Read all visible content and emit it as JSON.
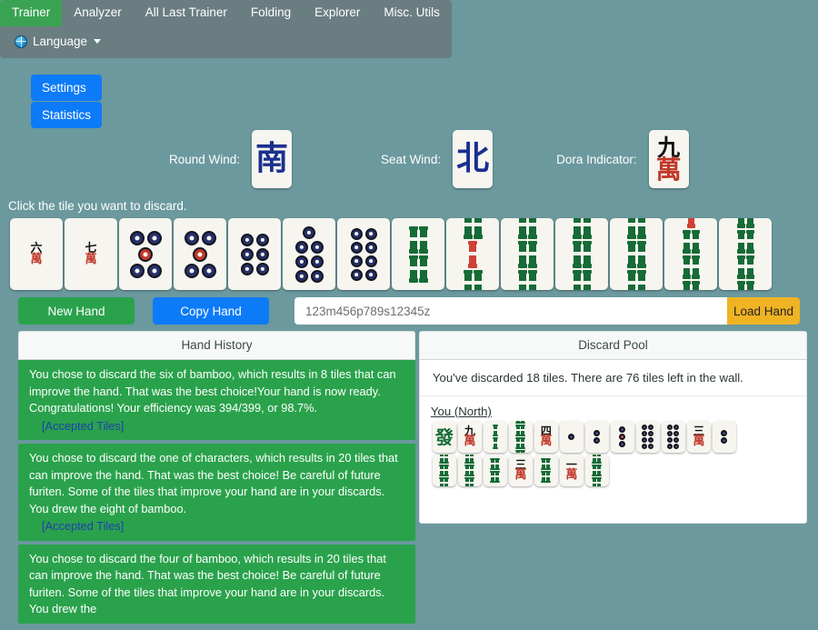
{
  "nav": {
    "tabs": [
      {
        "label": "Trainer",
        "active": true
      },
      {
        "label": "Analyzer",
        "active": false
      },
      {
        "label": "All Last Trainer",
        "active": false
      },
      {
        "label": "Folding",
        "active": false
      },
      {
        "label": "Explorer",
        "active": false
      },
      {
        "label": "Misc. Utils",
        "active": false
      }
    ],
    "language_label": "Language",
    "language_icon": "globe-icon",
    "caret_icon": "chevron-down-icon"
  },
  "side_buttons": [
    {
      "label": "Settings"
    },
    {
      "label": "Statistics"
    }
  ],
  "info": {
    "round_wind_label": "Round Wind:",
    "round_wind_tile": {
      "type": "honor",
      "glyph": "南",
      "name": "south-wind"
    },
    "seat_wind_label": "Seat Wind:",
    "seat_wind_tile": {
      "type": "honor",
      "glyph": "北",
      "name": "north-wind"
    },
    "dora_label": "Dora Indicator:",
    "dora_tile": {
      "type": "man",
      "num": "九",
      "wan": "萬",
      "name": "nine-of-characters"
    }
  },
  "prompt": "Click the tile you want to discard.",
  "hand": [
    {
      "type": "man",
      "num": "六",
      "wan": "萬",
      "name": "six-of-characters"
    },
    {
      "type": "man",
      "num": "七",
      "wan": "萬",
      "name": "seven-of-characters"
    },
    {
      "type": "pin",
      "count": 5,
      "red_index": 2,
      "name": "five-of-circles"
    },
    {
      "type": "pin",
      "count": 5,
      "red_index": 2,
      "name": "five-of-circles"
    },
    {
      "type": "pin",
      "count": 6,
      "red_index": -1,
      "name": "six-of-circles"
    },
    {
      "type": "pin",
      "count": 7,
      "red_index": -1,
      "name": "seven-of-circles"
    },
    {
      "type": "pin",
      "count": 8,
      "red_index": -1,
      "name": "eight-of-circles"
    },
    {
      "type": "sou",
      "count": 4,
      "red_index": -1,
      "name": "four-of-bamboo"
    },
    {
      "type": "sou",
      "count": 5,
      "red_index": 2,
      "name": "five-of-bamboo-red"
    },
    {
      "type": "sou",
      "count": 6,
      "red_index": -1,
      "name": "six-of-bamboo"
    },
    {
      "type": "sou",
      "count": 6,
      "red_index": -1,
      "name": "six-of-bamboo"
    },
    {
      "type": "sou",
      "count": 6,
      "red_index": -1,
      "name": "six-of-bamboo"
    },
    {
      "type": "sou",
      "count": 7,
      "red_index": 0,
      "name": "seven-of-bamboo"
    },
    {
      "type": "sou",
      "count": 8,
      "red_index": -1,
      "name": "eight-of-bamboo"
    }
  ],
  "controls": {
    "new_hand_label": "New Hand",
    "copy_hand_label": "Copy Hand",
    "hand_input_placeholder": "123m456p789s12345z",
    "hand_input_value": "",
    "load_hand_label": "Load Hand"
  },
  "hand_history": {
    "title": "Hand History",
    "accepted_tiles_label": "[Accepted Tiles]",
    "entries": [
      {
        "text": "You chose to discard the six of bamboo, which results in 8 tiles that can improve the hand. That was the best choice!Your hand is now ready. Congratulations! Your efficiency was 394/399, or 98.7%.",
        "has_accepted": true
      },
      {
        "text": "You chose to discard the one of characters, which results in 20 tiles that can improve the hand. That was the best choice! Be careful of future furiten. Some of the tiles that improve your hand are in your discards. You drew the eight of bamboo.",
        "has_accepted": true
      },
      {
        "text": "You chose to discard the four of bamboo, which results in 20 tiles that can improve the hand. That was the best choice! Be careful of future furiten. Some of the tiles that improve your hand are in your discards. You drew the",
        "has_accepted": false
      }
    ]
  },
  "discard_pool": {
    "title": "Discard Pool",
    "summary": "You've discarded 18 tiles. There are 76 tiles left in the wall.",
    "player_label": "You (North)",
    "rows": [
      [
        {
          "type": "hatsu",
          "glyph": "發",
          "name": "green-dragon"
        },
        {
          "type": "man",
          "num": "九",
          "wan": "萬",
          "name": "nine-of-characters"
        },
        {
          "type": "sou",
          "count": 2,
          "red_index": -1,
          "name": "two-of-bamboo"
        },
        {
          "type": "sou",
          "count": 8,
          "red_index": -1,
          "name": "eight-of-bamboo"
        },
        {
          "type": "man",
          "num": "四",
          "wan": "萬",
          "name": "four-of-characters"
        },
        {
          "type": "pin",
          "count": 1,
          "red_index": -1,
          "name": "one-of-circles"
        },
        {
          "type": "pin",
          "count": 2,
          "red_index": -1,
          "name": "two-of-circles"
        },
        {
          "type": "pin",
          "count": 3,
          "red_index": 1,
          "name": "three-of-circles"
        },
        {
          "type": "pin",
          "count": 8,
          "red_index": -1,
          "name": "eight-of-circles"
        },
        {
          "type": "pin",
          "count": 8,
          "red_index": -1,
          "name": "eight-of-circles"
        },
        {
          "type": "man",
          "num": "三",
          "wan": "萬",
          "name": "three-of-characters"
        },
        {
          "type": "pin",
          "count": 2,
          "red_index": -1,
          "name": "two-of-circles"
        }
      ],
      [
        {
          "type": "sou",
          "count": 6,
          "red_index": -1,
          "name": "six-of-bamboo"
        },
        {
          "type": "sou",
          "count": 6,
          "red_index": -1,
          "name": "six-of-bamboo"
        },
        {
          "type": "sou",
          "count": 4,
          "red_index": -1,
          "name": "four-of-bamboo"
        },
        {
          "type": "man",
          "num": "三",
          "wan": "萬",
          "name": "three-of-characters"
        },
        {
          "type": "sou",
          "count": 4,
          "red_index": -1,
          "name": "four-of-bamboo"
        },
        {
          "type": "man",
          "num": "一",
          "wan": "萬",
          "name": "one-of-characters"
        },
        {
          "type": "sou",
          "count": 6,
          "red_index": -1,
          "name": "six-of-bamboo"
        }
      ]
    ]
  },
  "colors": {
    "background": "#6b999e",
    "nav_bar": "#6a7d80",
    "active_tab": "#3aa353",
    "primary_blue": "#0d7bf7",
    "green": "#2aa24c",
    "amber": "#f0b323",
    "tile_face": "#f7f5ef",
    "man_red": "#c0392b",
    "sou_green": "#166b36",
    "pin_blue": "#26306b",
    "honor_blue": "#1a2f8f"
  }
}
